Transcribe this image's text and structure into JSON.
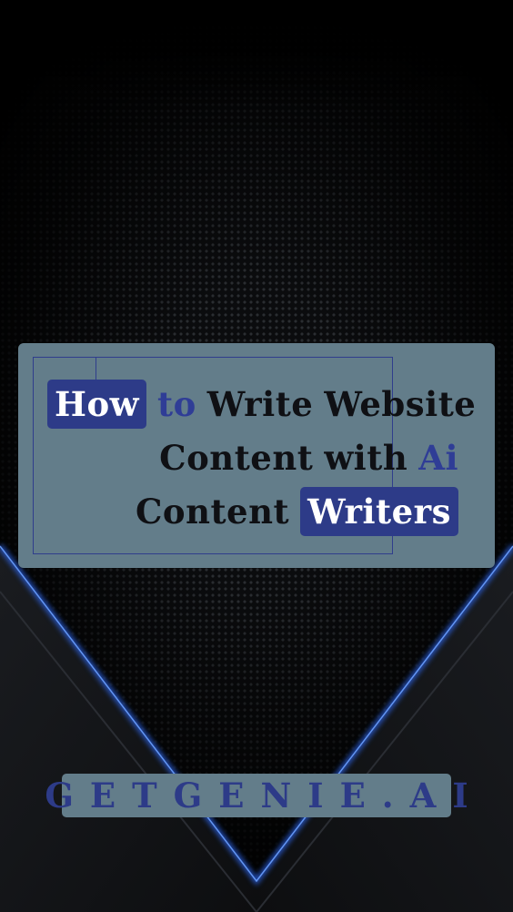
{
  "title": {
    "line1": [
      "How",
      "to",
      "Write",
      "Website"
    ],
    "line2": [
      "Content",
      "with",
      "Ai"
    ],
    "line3": [
      "Content",
      "Writers"
    ]
  },
  "brand": "GETGENIE.AI",
  "colors": {
    "background": "#0b0c0e",
    "card": "#637d8a",
    "accent": "#2d3b88",
    "glow": "#2e6cff",
    "text": "#0f1014",
    "highlight_text": "#ffffff"
  }
}
